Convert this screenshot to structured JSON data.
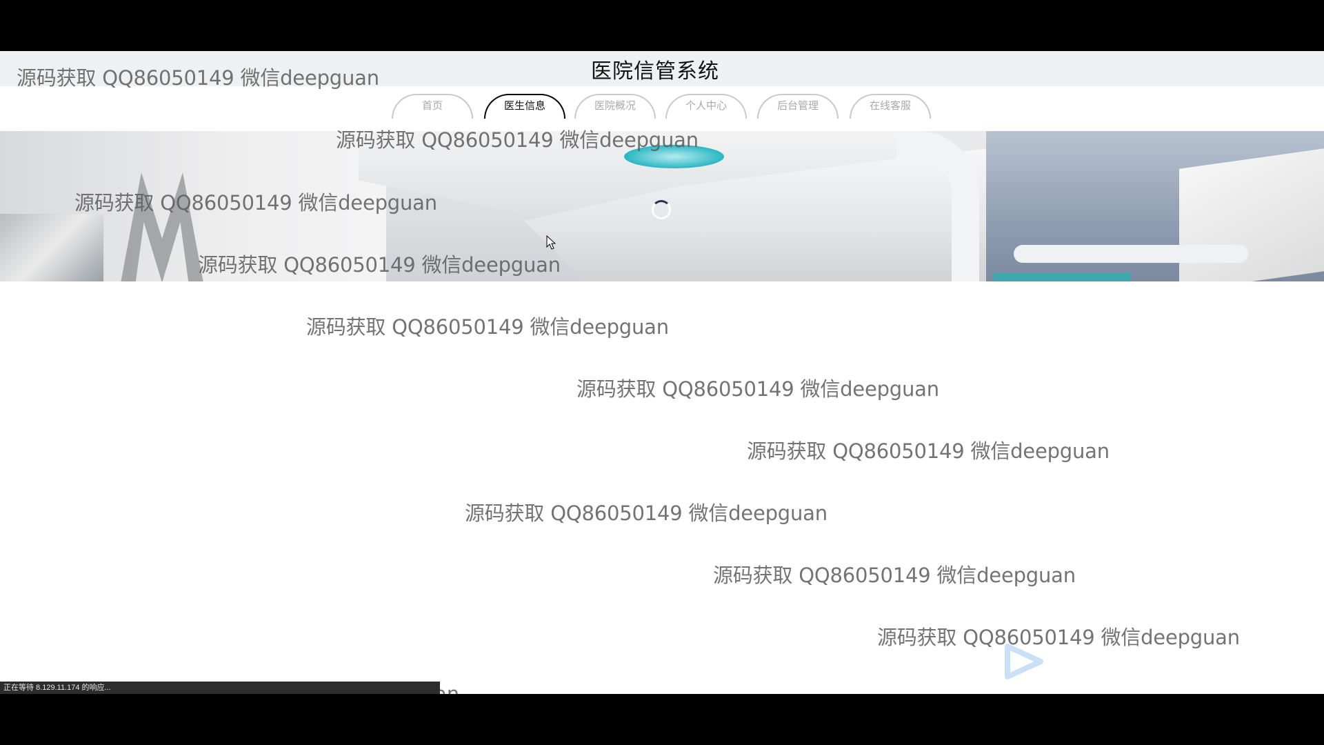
{
  "header": {
    "title": "医院信管系统"
  },
  "nav": {
    "tabs": [
      {
        "label": "首页"
      },
      {
        "label": "医生信息"
      },
      {
        "label": "医院概况"
      },
      {
        "label": "个人中心"
      },
      {
        "label": "后台管理"
      },
      {
        "label": "在线客服"
      }
    ],
    "active_index": 1
  },
  "watermark": {
    "text": "源码获取 QQ86050149 微信deepguan"
  },
  "status_bar": {
    "text": "正在等待 8.129.11.174 的响应..."
  },
  "icons": [
    "cursor-arrow-icon",
    "loading-spinner-icon",
    "play-logo-icon"
  ],
  "colors": {
    "active_tab_border": "#000000",
    "inactive_tab_border": "#c9c9c9",
    "accent_teal": "#2ab7c3"
  }
}
